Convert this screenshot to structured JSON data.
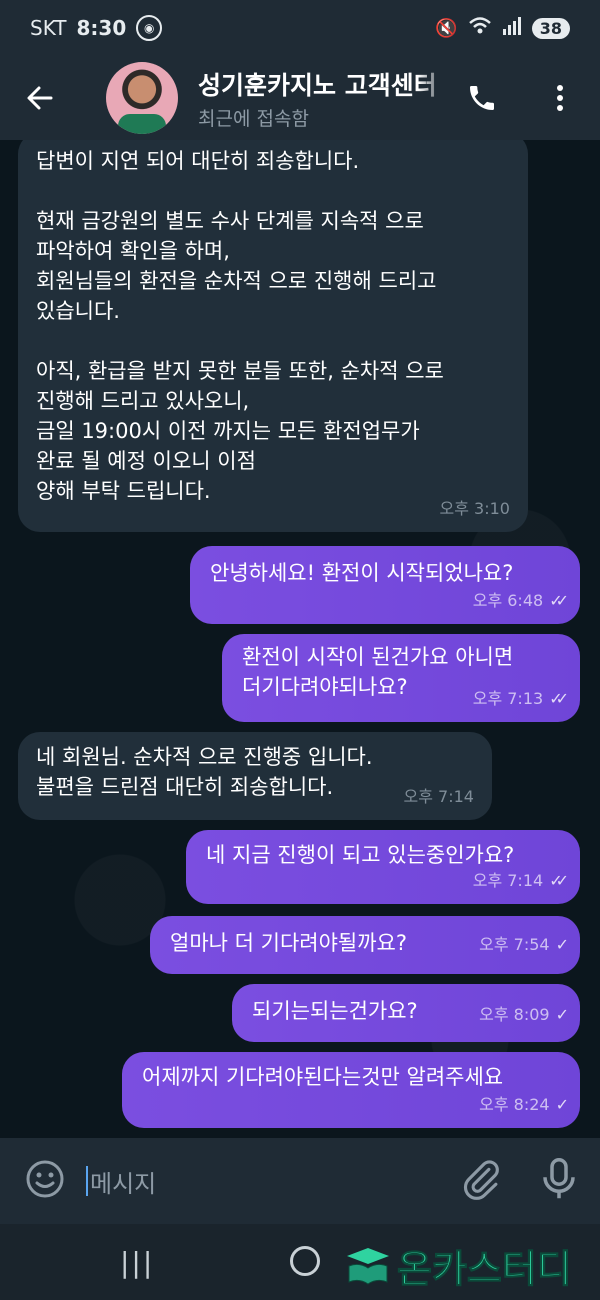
{
  "status_bar": {
    "carrier": "SKT",
    "time": "8:30",
    "battery": "38"
  },
  "header": {
    "contact_name": "성기훈카지노 고객센터",
    "status": "최근에 접속함"
  },
  "messages": [
    {
      "direction": "in",
      "text": "답변이 지연 되어 대단히 죄송합니다.\n\n현재 금강원의 별도 수사 단계를 지속적 으로\n파악하여 확인을 하며,\n회원님들의 환전을 순차적 으로 진행해 드리고\n있습니다.\n\n아직, 환급을 받지 못한 분들 또한, 순차적 으로\n진행해 드리고 있사오니,\n금일 19:00시 이전 까지는 모든 환전업무가\n완료 될 예정 이오니 이점\n양해 부탁 드립니다.",
      "time": "오후 3:10"
    },
    {
      "direction": "out",
      "text": "안녕하세요! 환전이 시작되었나요?",
      "time": "오후 6:48",
      "read": true
    },
    {
      "direction": "out",
      "text": "환전이 시작이 된건가요 아니면\n더기다려야되나요?",
      "time": "오후 7:13",
      "read": true
    },
    {
      "direction": "in",
      "text": "네 회원님. 순차적 으로 진행중 입니다.\n불편을 드린점 대단히 죄송합니다.",
      "time": "오후 7:14"
    },
    {
      "direction": "out",
      "text": "네 지금 진행이 되고 있는중인가요?",
      "time": "오후 7:14",
      "read": true
    },
    {
      "direction": "out",
      "text": "얼마나 더 기다려야될까요?",
      "time": "오후 7:54",
      "read": false
    },
    {
      "direction": "out",
      "text": "되기는되는건가요?",
      "time": "오후 8:09",
      "read": false
    },
    {
      "direction": "out",
      "text": "어제까지 기다려야된다는것만 알려주세요",
      "time": "오후 8:24",
      "read": false
    }
  ],
  "composer": {
    "placeholder": "메시지"
  },
  "watermark": {
    "text": "온카스터디"
  },
  "colors": {
    "outgoing_bubble": "#7347dc",
    "incoming_bubble": "#212f3a",
    "header_bg": "#1f2b35",
    "chat_bg": "#0b161d"
  }
}
